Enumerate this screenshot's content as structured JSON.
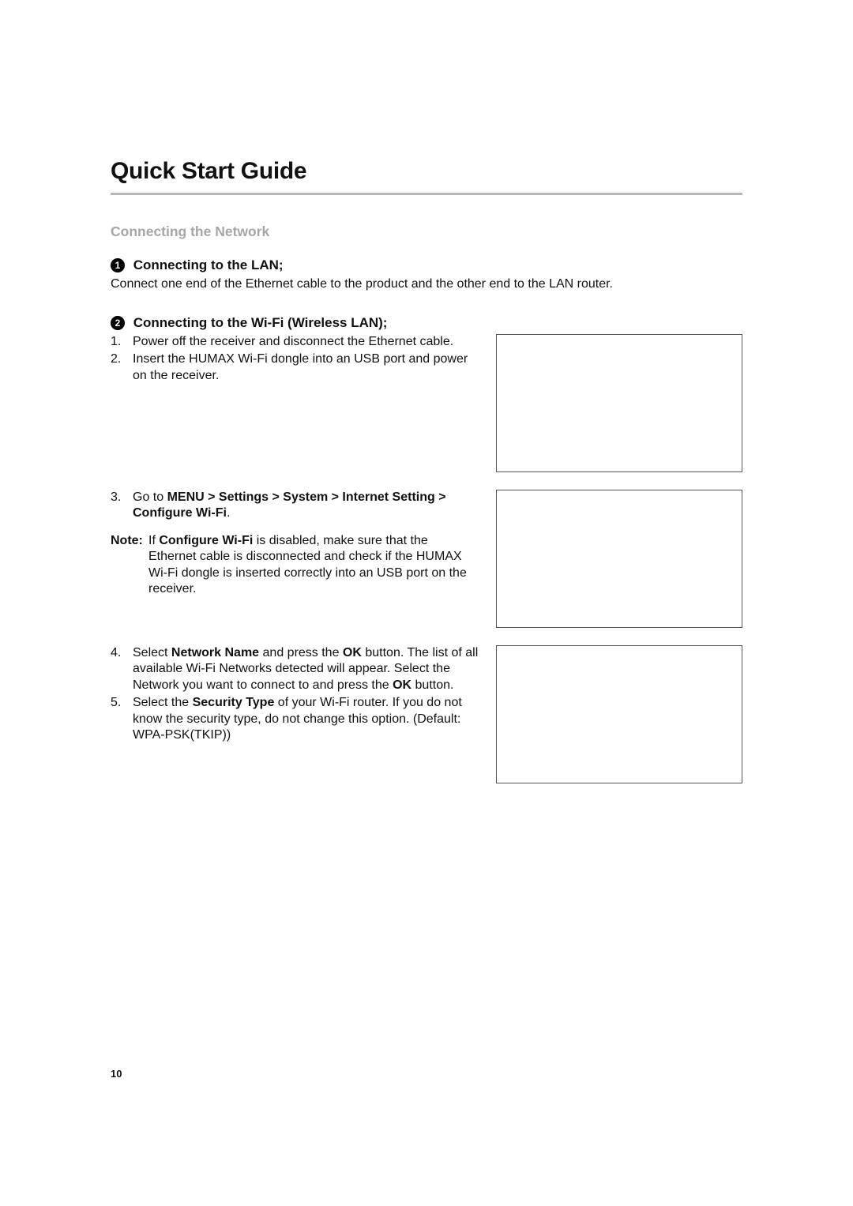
{
  "title": "Quick Start Guide",
  "section": "Connecting the Network",
  "sub1": {
    "num": "1",
    "heading": "Connecting to the LAN;",
    "body": "Connect one end of the Ethernet cable to the product and the other end to the LAN router."
  },
  "sub2": {
    "num": "2",
    "heading": "Connecting to the Wi-Fi (Wireless LAN);",
    "step1": "Power off the receiver and disconnect the Ethernet cable.",
    "step2": "Insert the HUMAX Wi-Fi dongle into an USB port and power on the receiver.",
    "step3_pre": "Go to ",
    "step3_bold": "MENU > Settings > System > Internet Setting > Configure Wi-Fi",
    "step3_post": ".",
    "note_label": "Note:",
    "note_pre": "If ",
    "note_bold": "Configure Wi-Fi",
    "note_post": " is disabled, make sure that the Ethernet cable is disconnected and check if the HUMAX Wi-Fi dongle is inserted correctly into an USB port on the receiver.",
    "step4_a": "Select ",
    "step4_b": "Network Name",
    "step4_c": " and press the ",
    "step4_d": "OK",
    "step4_e": " button. The list of all available Wi-Fi Networks detected will appear. Select the Network you want to connect to and press the ",
    "step4_f": "OK",
    "step4_g": " button.",
    "step5_a": "Select the ",
    "step5_b": "Security Type",
    "step5_c": " of your Wi-Fi router. If you do not know the security type, do not change this option. (Default: WPA-PSK(TKIP))"
  },
  "page_number": "10"
}
